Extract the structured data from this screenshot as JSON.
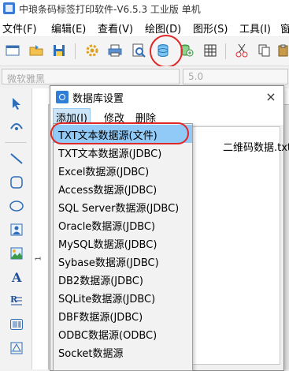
{
  "window": {
    "title": "中琅条码标签打印软件-V6.5.3 工业版 单机"
  },
  "menubar": {
    "items": [
      "文件(F)",
      "编辑(E)",
      "查看(V)",
      "绘图(D)",
      "图形(S)",
      "工具(I)",
      "窗"
    ]
  },
  "toolbar": {
    "icons": [
      "new-icon",
      "open-icon",
      "save-icon",
      "settings-icon",
      "print-icon",
      "print-preview-icon",
      "database-icon",
      "database-link-icon",
      "grid-icon",
      "cut-icon",
      "copy-icon",
      "paste-icon"
    ],
    "highlighted": "database-icon",
    "highlight_color": "#e02828"
  },
  "fontbar": {
    "font_value": "微软雅黑",
    "size_value": "5.0"
  },
  "leftpanel": {
    "tools": [
      "select-tool-icon",
      "pan-tool-icon",
      "line-tool-icon",
      "rounded-rect-tool-icon",
      "ellipse-tool-icon",
      "image-tool-icon",
      "picture-tool-icon",
      "text-tool-icon",
      "rich-text-tool-icon",
      "barcode-tool-icon",
      "qrcode-tool-icon"
    ]
  },
  "ruler": {
    "left_mark": "1"
  },
  "dialog": {
    "title": "数据库设置",
    "close": "×",
    "menu": [
      "添加(I)",
      "修改",
      "删除"
    ],
    "entries": [
      "二维码数据.txt"
    ]
  },
  "dropdown": {
    "items": [
      "TXT文本数据源(文件)",
      "TXT文本数据源(JDBC)",
      "Excel数据源(JDBC)",
      "Access数据源(JDBC)",
      "SQL Server数据源(JDBC)",
      "Oracle数据源(JDBC)",
      "MySQL数据源(JDBC)",
      "Sybase数据源(JDBC)",
      "DB2数据源(JDBC)",
      "SQLite数据源(JDBC)",
      "DBF数据源(JDBC)",
      "ODBC数据源(ODBC)",
      "Socket数据源"
    ],
    "selected_index": 0,
    "selected_color": "#91c9f7"
  }
}
